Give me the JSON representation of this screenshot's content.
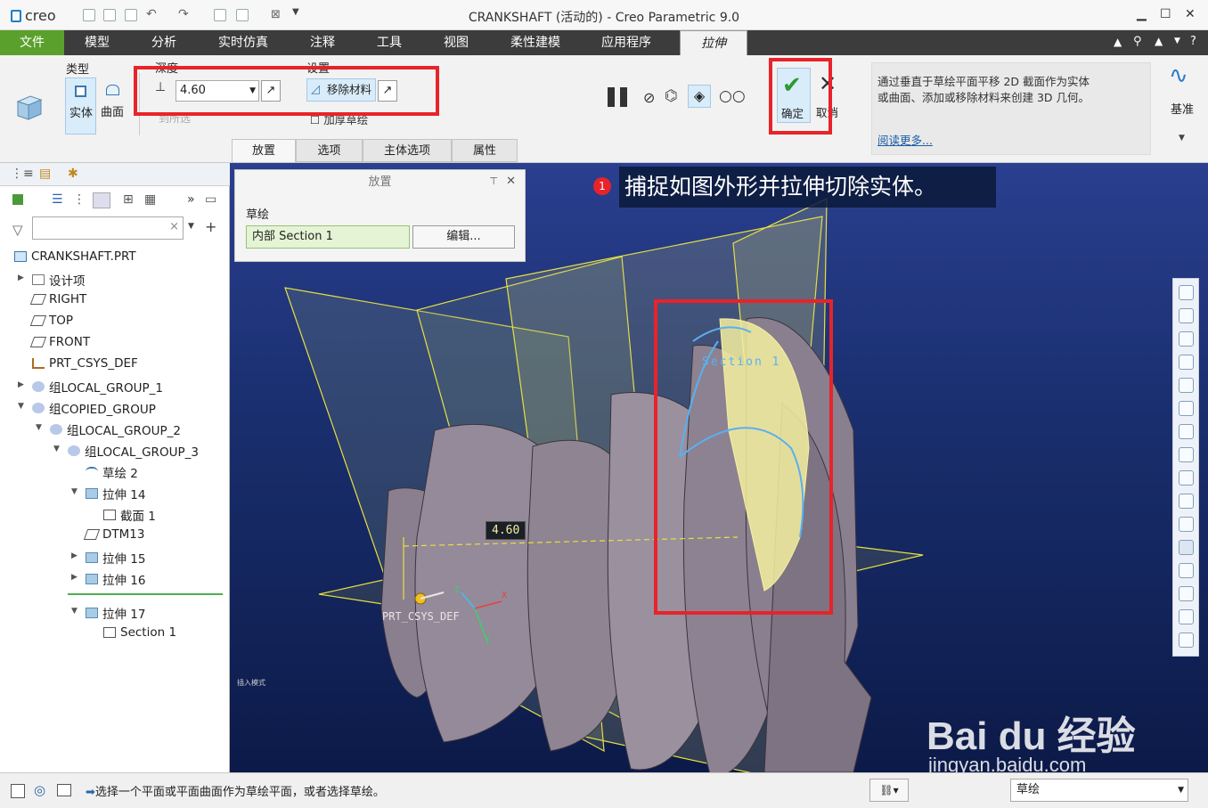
{
  "app": {
    "logo_text": "creo",
    "window_title": "CRANKSHAFT (活动的) - Creo Parametric 9.0"
  },
  "tabs": [
    {
      "label": "文件"
    },
    {
      "label": "模型"
    },
    {
      "label": "分析"
    },
    {
      "label": "实时仿真"
    },
    {
      "label": "注释"
    },
    {
      "label": "工具"
    },
    {
      "label": "视图"
    },
    {
      "label": "柔性建模"
    },
    {
      "label": "应用程序"
    },
    {
      "label": "拉伸"
    }
  ],
  "ribbon": {
    "type_label": "类型",
    "solid_label": "实体",
    "surface_label": "曲面",
    "depth_label": "深度",
    "depth_value": "4.60",
    "to_selected_label": "到所选",
    "settings_label": "设置",
    "remove_material_label": "移除材料",
    "thicken_label": "加厚草绘",
    "ok_label": "确定",
    "cancel_label": "取消",
    "help_text": "通过垂直于草绘平面平移 2D 截面作为实体或曲面、添加或移除材料来创建 3D 几何。",
    "help_link": "阅读更多...",
    "datum_label": "基准"
  },
  "subtabs": [
    {
      "label": "放置"
    },
    {
      "label": "选项"
    },
    {
      "label": "主体选项"
    },
    {
      "label": "属性"
    }
  ],
  "placement_panel": {
    "title": "放置",
    "sketch_label": "草绘",
    "sketch_value": "内部 Section 1",
    "edit_button": "编辑..."
  },
  "callout": {
    "number": "1",
    "text": "捕捉如图外形并拉伸切除实体。"
  },
  "tree": {
    "root": "CRANKSHAFT.PRT",
    "items": [
      {
        "label": "设计项"
      },
      {
        "label": "RIGHT"
      },
      {
        "label": "TOP"
      },
      {
        "label": "FRONT"
      },
      {
        "label": "PRT_CSYS_DEF"
      },
      {
        "label": "组LOCAL_GROUP_1"
      },
      {
        "label": "组COPIED_GROUP"
      },
      {
        "label": "组LOCAL_GROUP_2"
      },
      {
        "label": "组LOCAL_GROUP_3"
      },
      {
        "label": "草绘 2"
      },
      {
        "label": "拉伸 14"
      },
      {
        "label": "截面 1"
      },
      {
        "label": "DTM13"
      },
      {
        "label": "拉伸 15"
      },
      {
        "label": "拉伸 16"
      },
      {
        "label": "拉伸 17"
      },
      {
        "label": "Section 1"
      }
    ]
  },
  "viewport": {
    "dimension_value": "4.60",
    "section_label": "Section 1",
    "csys_label": "PRT_CSYS_DEF",
    "insert_mode": "插入模式",
    "axis_x": "X",
    "axis_y": "Y",
    "axis_z": "Z"
  },
  "status": {
    "message": "选择一个平面或平面曲面作为草绘平面，或者选择草绘。",
    "filter_value": "草绘"
  },
  "watermark": {
    "brand": "Bai du 经验",
    "url": "jingyan.baidu.com"
  },
  "colors": {
    "file_tab": "#5aa02c",
    "highlight_red": "#e8232a",
    "viewport_top": "#2a3f8f",
    "sketch_yellow": "#f4f0a0"
  }
}
